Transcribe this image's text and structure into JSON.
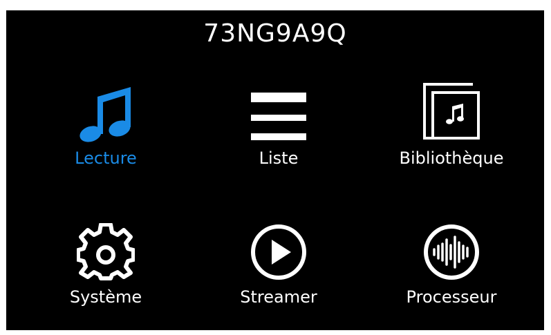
{
  "device": {
    "name": "73NG9A9Q"
  },
  "colors": {
    "background": "#000000",
    "foreground": "#ffffff",
    "accent": "#1a8be6"
  },
  "menu": {
    "items": [
      {
        "label": "Lecture",
        "icon": "music-note-icon",
        "active": true
      },
      {
        "label": "Liste",
        "icon": "list-icon",
        "active": false
      },
      {
        "label": "Bibliothèque",
        "icon": "album-library-icon",
        "active": false
      },
      {
        "label": "Système",
        "icon": "gear-icon",
        "active": false
      },
      {
        "label": "Streamer",
        "icon": "play-circle-icon",
        "active": false
      },
      {
        "label": "Processeur",
        "icon": "audio-waveform-icon",
        "active": false
      }
    ]
  }
}
